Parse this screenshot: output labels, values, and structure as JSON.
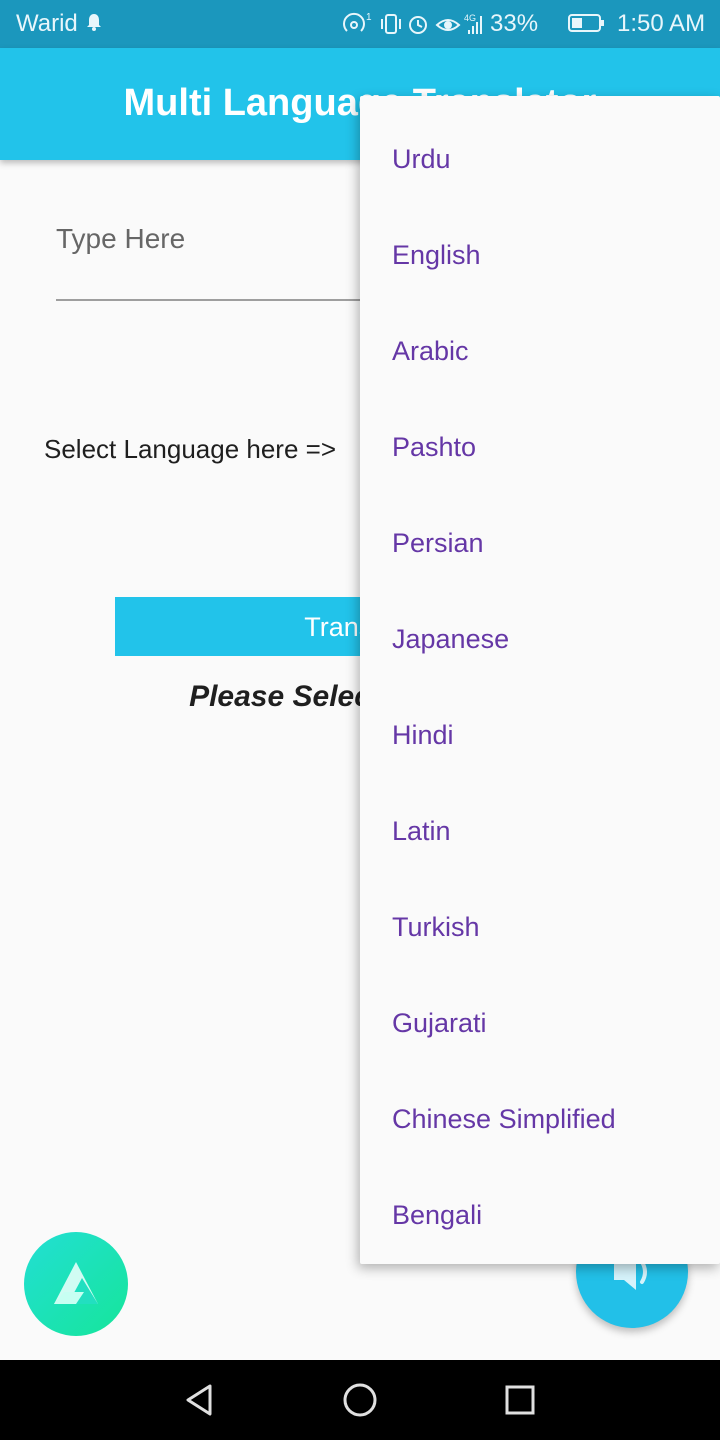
{
  "status_bar": {
    "carrier": "Warid",
    "battery_percent": "33%",
    "time": "1:50 AM",
    "network_label": "4G",
    "icons": [
      "hotspot-icon",
      "vibrate-icon",
      "alarm-icon",
      "eye-comfort-icon",
      "signal-icon",
      "battery-icon",
      "notification-bell-icon"
    ]
  },
  "app_bar": {
    "title": "Multi Language Translator"
  },
  "input": {
    "placeholder": "Type Here",
    "value": ""
  },
  "select_label": "Select Language here =>",
  "translate_button": "Translate",
  "result_text": "Please Select Language",
  "language_menu": {
    "items": [
      "Urdu",
      "English",
      "Arabic",
      "Pashto",
      "Persian",
      "Japanese",
      "Hindi",
      "Latin",
      "Turkish",
      "Gujarati",
      "Chinese Simplified",
      "Bengali"
    ]
  },
  "colors": {
    "status_bar": "#1b97bd",
    "app_bar": "#22c3ea",
    "menu_text": "#6537a6",
    "fab": "#22c0e8"
  }
}
